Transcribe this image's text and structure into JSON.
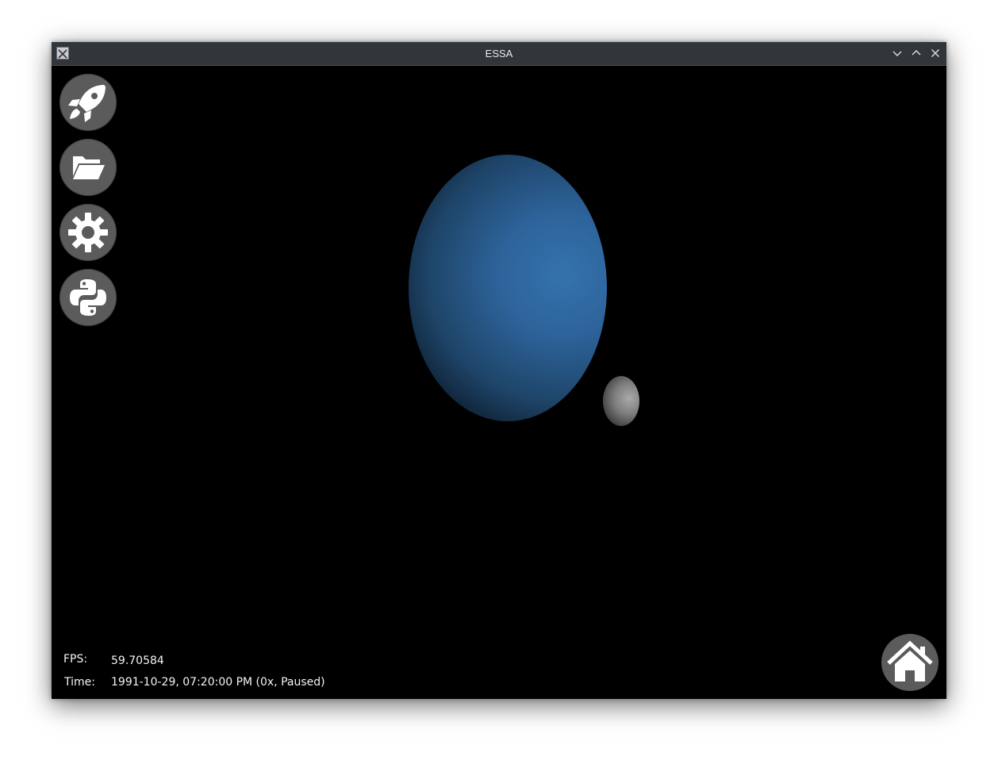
{
  "window": {
    "title": "ESSA"
  },
  "titlebar_buttons": [
    {
      "name": "minimize",
      "icon": "chevron-down-icon"
    },
    {
      "name": "maximize",
      "icon": "chevron-up-icon"
    },
    {
      "name": "close",
      "icon": "close-icon"
    }
  ],
  "toolbar": {
    "buttons": [
      {
        "name": "simulation",
        "icon": "rocket-icon"
      },
      {
        "name": "open-file",
        "icon": "folder-open-icon"
      },
      {
        "name": "settings",
        "icon": "gear-icon"
      },
      {
        "name": "python-console",
        "icon": "python-icon"
      }
    ],
    "home": {
      "icon": "home-icon"
    }
  },
  "hud": {
    "fps_label": "FPS:",
    "fps_value": "59.70584",
    "time_label": "Time:",
    "time_value": "1991-10-29, 07:20:00 PM (0x, Paused)"
  },
  "scene": {
    "planet_color": "#3572ad",
    "moon_color": "#a9a9a9",
    "background_color": "#000000"
  }
}
